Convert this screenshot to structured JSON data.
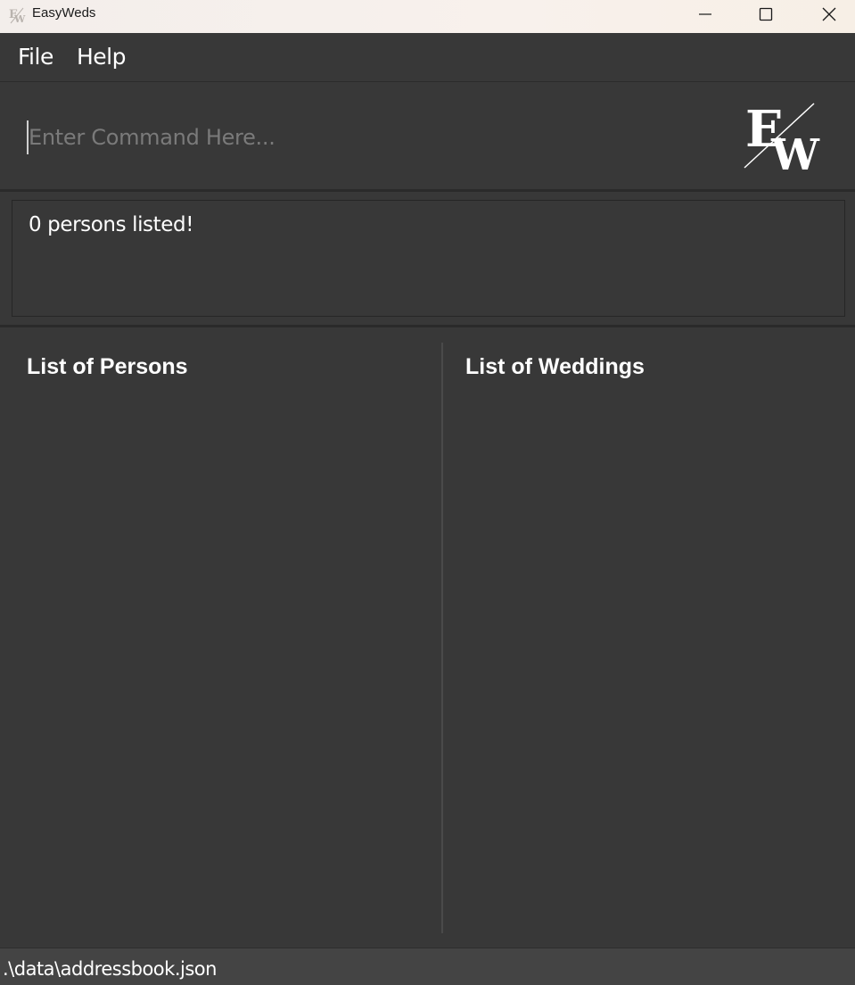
{
  "window": {
    "title": "EasyWeds",
    "icon": "easyweds-logo-icon",
    "controls": [
      "minimize-icon",
      "maximize-icon",
      "close-icon"
    ]
  },
  "menu": {
    "items": [
      {
        "label": "File"
      },
      {
        "label": "Help"
      }
    ]
  },
  "command": {
    "value": "",
    "placeholder": "Enter Command Here..."
  },
  "logo": {
    "letters": "EW"
  },
  "result": {
    "text": "0 persons listed!"
  },
  "lists": {
    "persons": {
      "title": "List of Persons",
      "items": []
    },
    "weddings": {
      "title": "List of Weddings",
      "items": []
    }
  },
  "status": {
    "file_path": ".\\data\\addressbook.json"
  },
  "colors": {
    "background": "#383838",
    "titlebar": "#f5efea",
    "statusbar": "#444444",
    "text": "#ffffff",
    "placeholder": "#7a7a7a"
  }
}
